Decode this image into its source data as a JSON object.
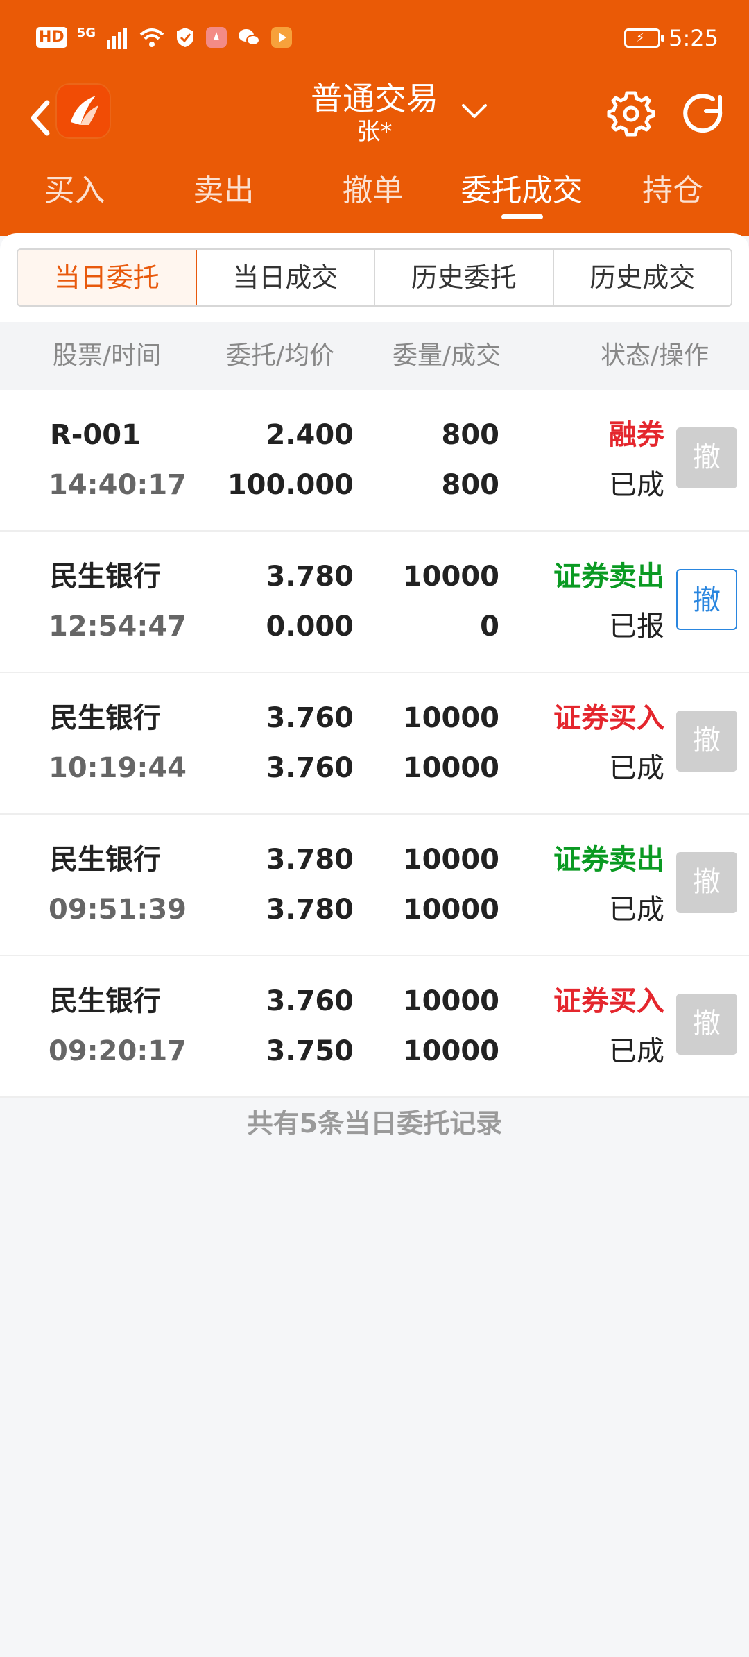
{
  "status_bar": {
    "left_badges": [
      "HD",
      "5G"
    ],
    "time": "5:25"
  },
  "header": {
    "title": "普通交易",
    "subtitle": "张*"
  },
  "main_tabs": [
    {
      "label": "买入"
    },
    {
      "label": "卖出"
    },
    {
      "label": "撤单"
    },
    {
      "label": "委托成交"
    },
    {
      "label": "持仓"
    }
  ],
  "segments": [
    {
      "label": "当日委托"
    },
    {
      "label": "当日成交"
    },
    {
      "label": "历史委托"
    },
    {
      "label": "历史成交"
    }
  ],
  "table": {
    "columns": [
      "股票/时间",
      "委托/均价",
      "委量/成交",
      "状态/操作"
    ],
    "rows": [
      {
        "stock": "R-001",
        "time": "14:40:17",
        "order_price": "2.400",
        "avg_price": "100.000",
        "order_qty": "800",
        "filled_qty": "800",
        "type": "融券",
        "status": "已成",
        "cancel": "撤",
        "type_color": "#e4262d",
        "cancel_enabled": false
      },
      {
        "stock": "民生银行",
        "time": "12:54:47",
        "order_price": "3.780",
        "avg_price": "0.000",
        "order_qty": "10000",
        "filled_qty": "0",
        "type": "证券卖出",
        "status": "已报",
        "cancel": "撤",
        "type_color": "#0a9a22",
        "cancel_enabled": true
      },
      {
        "stock": "民生银行",
        "time": "10:19:44",
        "order_price": "3.760",
        "avg_price": "3.760",
        "order_qty": "10000",
        "filled_qty": "10000",
        "type": "证券买入",
        "status": "已成",
        "cancel": "撤",
        "type_color": "#e4262d",
        "cancel_enabled": false
      },
      {
        "stock": "民生银行",
        "time": "09:51:39",
        "order_price": "3.780",
        "avg_price": "3.780",
        "order_qty": "10000",
        "filled_qty": "10000",
        "type": "证券卖出",
        "status": "已成",
        "cancel": "撤",
        "type_color": "#0a9a22",
        "cancel_enabled": false
      },
      {
        "stock": "民生银行",
        "time": "09:20:17",
        "order_price": "3.760",
        "avg_price": "3.750",
        "order_qty": "10000",
        "filled_qty": "10000",
        "type": "证券买入",
        "status": "已成",
        "cancel": "撤",
        "type_color": "#e4262d",
        "cancel_enabled": false
      }
    ]
  },
  "footer_note": "共有5条当日委托记录",
  "colors": {
    "brand": "#ea5a06",
    "buy_red": "#e4262d",
    "sell_green": "#0a9a22",
    "link_blue": "#2a86df"
  }
}
